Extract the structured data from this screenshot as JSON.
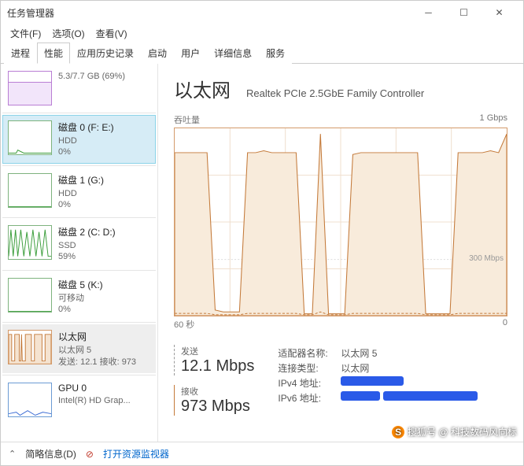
{
  "window": {
    "title": "任务管理器"
  },
  "menu": {
    "file": "文件(F)",
    "options": "选项(O)",
    "view": "查看(V)"
  },
  "tabs": {
    "processes": "进程",
    "performance": "性能",
    "app_history": "应用历史记录",
    "startup": "启动",
    "users": "用户",
    "details": "详细信息",
    "services": "服务"
  },
  "sidebar": {
    "memory": {
      "name": "",
      "sub1": "5.3/7.7 GB (69%)"
    },
    "items": [
      {
        "name": "磁盘 0 (F: E:)",
        "sub1": "HDD",
        "sub2": "0%"
      },
      {
        "name": "磁盘 1 (G:)",
        "sub1": "HDD",
        "sub2": "0%"
      },
      {
        "name": "磁盘 2 (C: D:)",
        "sub1": "SSD",
        "sub2": "59%"
      },
      {
        "name": "磁盘 5 (K:)",
        "sub1": "可移动",
        "sub2": "0%"
      },
      {
        "name": "以太网",
        "sub1": "以太网 5",
        "sub2": "发送: 12.1 接收: 973"
      },
      {
        "name": "GPU 0",
        "sub1": "Intel(R) HD Grap..."
      }
    ]
  },
  "main": {
    "title": "以太网",
    "adapter": "Realtek PCIe 2.5GbE Family Controller",
    "throughput_label": "吞吐量",
    "max_label": "1 Gbps",
    "mid_label": "300 Mbps",
    "x_left": "60 秒",
    "x_right": "0",
    "send_label": "发送",
    "send_value": "12.1 Mbps",
    "recv_label": "接收",
    "recv_value": "973 Mbps",
    "details": {
      "adapter_name_k": "适配器名称:",
      "adapter_name_v": "以太网 5",
      "conn_type_k": "连接类型:",
      "conn_type_v": "以太网",
      "ipv4_k": "IPv4 地址:",
      "ipv6_k": "IPv6 地址:"
    }
  },
  "footer": {
    "brief": "简略信息(D)",
    "resmon": "打开资源监视器"
  },
  "watermark": "搜狐号 @ 科技数码风向标",
  "chart_data": {
    "type": "area",
    "xlabel": "60 秒",
    "ylabel": "吞吐量",
    "ylim": [
      0,
      1000
    ],
    "y_unit": "Mbps",
    "gridline_at": 300,
    "series": [
      {
        "name": "接收",
        "values": [
          870,
          870,
          870,
          870,
          870,
          30,
          20,
          20,
          20,
          870,
          870,
          880,
          870,
          870,
          870,
          870,
          10,
          10,
          970,
          10,
          10,
          10,
          860,
          870,
          870,
          870,
          870,
          870,
          870,
          870,
          870,
          10,
          10,
          10,
          10,
          870,
          870,
          870,
          870,
          880,
          870,
          970
        ]
      },
      {
        "name": "发送",
        "values": [
          12,
          12,
          12,
          12,
          12,
          5,
          5,
          5,
          5,
          12,
          12,
          12,
          12,
          12,
          12,
          12,
          5,
          5,
          20,
          5,
          5,
          5,
          12,
          12,
          12,
          12,
          12,
          12,
          12,
          12,
          12,
          5,
          5,
          5,
          5,
          12,
          12,
          12,
          12,
          12,
          12,
          12
        ]
      }
    ]
  }
}
